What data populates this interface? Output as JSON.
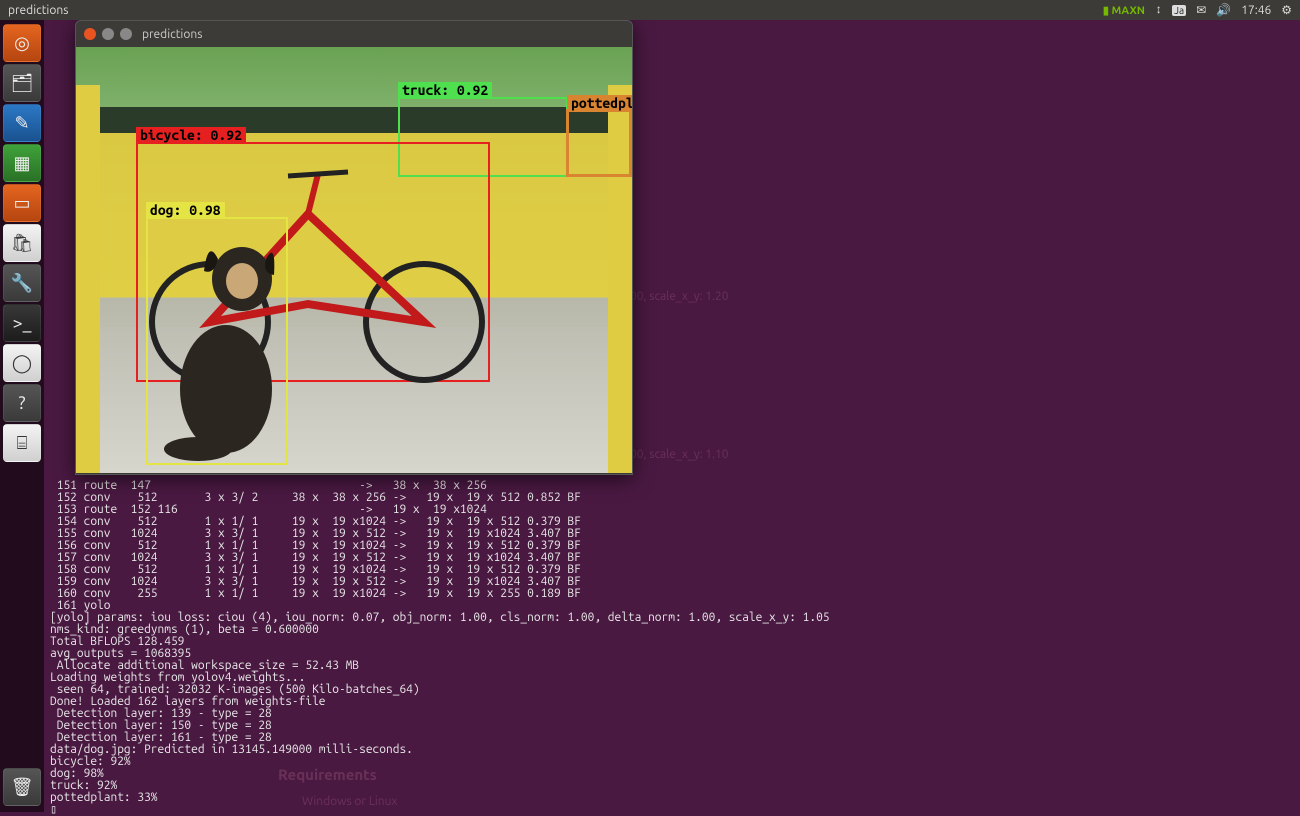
{
  "menu": {
    "title": "predictions",
    "nvidia": "MAXN",
    "time": "17:46"
  },
  "launcher": {
    "items": [
      "search",
      "files",
      "writer",
      "calc",
      "impress",
      "software",
      "settings",
      "terminal",
      "chromium",
      "help",
      "devices"
    ],
    "trash": "trash"
  },
  "window": {
    "title": "predictions",
    "detections": {
      "truck": "truck: 0.92",
      "pottedplant": "pottedpla",
      "bicycle": "bicycle: 0.92",
      "dog": "dog: 0.98"
    }
  },
  "bg": {
    "a": "00, scale_x_y: 1.20",
    "b": "00, scale_x_y: 1.10",
    "c": "Requirements",
    "d": "Windows or Linux"
  },
  "term": {
    "lines": "\n\n\n\n\n\n\n\n\n\n\n\n\n\n\n\n\n\n\n\n\n\n\n\n\n\n\n\n\n\n\n\n\n\n\n\n\n\n 151 route  147                               ->   38 x  38 x 256\n 152 conv    512       3 x 3/ 2     38 x  38 x 256 ->   19 x  19 x 512 0.852 BF\n 153 route  152 116                           ->   19 x  19 x1024\n 154 conv    512       1 x 1/ 1     19 x  19 x1024 ->   19 x  19 x 512 0.379 BF\n 155 conv   1024       3 x 3/ 1     19 x  19 x 512 ->   19 x  19 x1024 3.407 BF\n 156 conv    512       1 x 1/ 1     19 x  19 x1024 ->   19 x  19 x 512 0.379 BF\n 157 conv   1024       3 x 3/ 1     19 x  19 x 512 ->   19 x  19 x1024 3.407 BF\n 158 conv    512       1 x 1/ 1     19 x  19 x1024 ->   19 x  19 x 512 0.379 BF\n 159 conv   1024       3 x 3/ 1     19 x  19 x 512 ->   19 x  19 x1024 3.407 BF\n 160 conv    255       1 x 1/ 1     19 x  19 x1024 ->   19 x  19 x 255 0.189 BF\n 161 yolo\n[yolo] params: iou loss: ciou (4), iou_norm: 0.07, obj_norm: 1.00, cls_norm: 1.00, delta_norm: 1.00, scale_x_y: 1.05\nnms_kind: greedynms (1), beta = 0.600000\nTotal BFLOPS 128.459\navg_outputs = 1068395\n Allocate additional workspace_size = 52.43 MB\nLoading weights from yolov4.weights...\n seen 64, trained: 32032 K-images (500 Kilo-batches_64)\nDone! Loaded 162 layers from weights-file\n Detection layer: 139 - type = 28\n Detection layer: 150 - type = 28\n Detection layer: 161 - type = 28\ndata/dog.jpg: Predicted in 13145.149000 milli-seconds.\nbicycle: 92%\ndog: 98%\ntruck: 92%\npottedplant: 33%\n▯"
  }
}
